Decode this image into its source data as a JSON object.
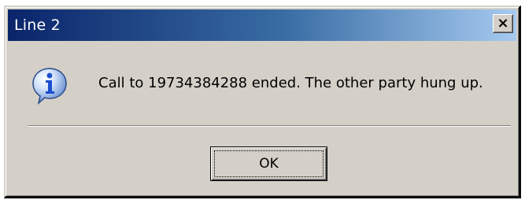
{
  "window": {
    "title": "Line 2",
    "close_label": "×",
    "close_icon": "close-icon"
  },
  "content": {
    "icon": "info-icon",
    "message": "Call to 19734384288 ended. The other party hung up."
  },
  "buttons": {
    "ok_label": "OK"
  },
  "colors": {
    "titlebar_start": "#0a246a",
    "titlebar_end": "#a6caf0",
    "dialog_bg": "#d4d0c8",
    "icon_blue": "#1a4fd0"
  }
}
